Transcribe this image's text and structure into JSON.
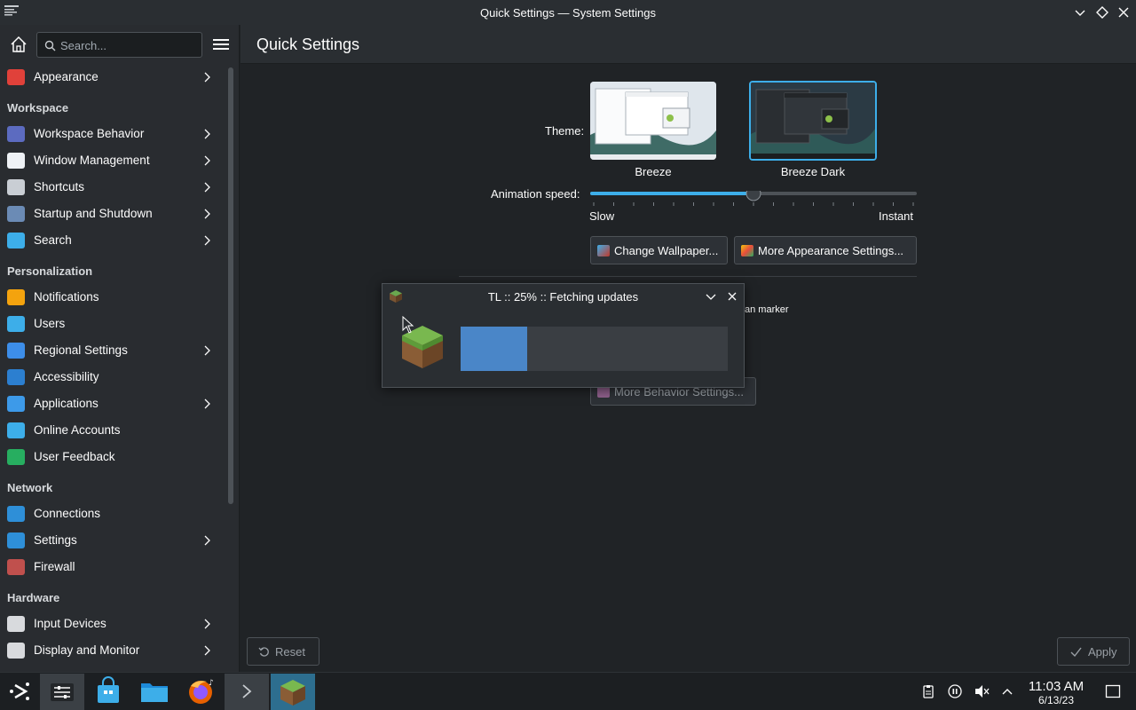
{
  "window": {
    "title": "Quick Settings — System Settings"
  },
  "sidebar": {
    "search_placeholder": "Search...",
    "items": [
      {
        "type": "item",
        "label": "Appearance",
        "icon": "appearance-icon",
        "color": "#e0413a",
        "chevron": true
      },
      {
        "type": "section",
        "label": "Workspace"
      },
      {
        "type": "item",
        "label": "Workspace Behavior",
        "icon": "workspace-behavior-icon",
        "color": "#5c6bc0",
        "chevron": true
      },
      {
        "type": "item",
        "label": "Window Management",
        "icon": "window-management-icon",
        "color": "#eef1f5",
        "chevron": true
      },
      {
        "type": "item",
        "label": "Shortcuts",
        "icon": "keyboard-icon",
        "color": "#c9ced4",
        "chevron": true
      },
      {
        "type": "item",
        "label": "Startup and Shutdown",
        "icon": "startup-icon",
        "color": "#6b8bb5",
        "chevron": true
      },
      {
        "type": "item",
        "label": "Search",
        "icon": "search-icon",
        "color": "#3daee9",
        "chevron": true
      },
      {
        "type": "section",
        "label": "Personalization"
      },
      {
        "type": "item",
        "label": "Notifications",
        "icon": "bell-icon",
        "color": "#f4a30e",
        "chevron": false
      },
      {
        "type": "item",
        "label": "Users",
        "icon": "users-icon",
        "color": "#3daee9",
        "chevron": false
      },
      {
        "type": "item",
        "label": "Regional Settings",
        "icon": "regional-icon",
        "color": "#3d8ee9",
        "chevron": true
      },
      {
        "type": "item",
        "label": "Accessibility",
        "icon": "accessibility-icon",
        "color": "#2c7fd0",
        "chevron": false
      },
      {
        "type": "item",
        "label": "Applications",
        "icon": "applications-icon",
        "color": "#3d9ae9",
        "chevron": true
      },
      {
        "type": "item",
        "label": "Online Accounts",
        "icon": "online-accounts-icon",
        "color": "#3daee9",
        "chevron": false
      },
      {
        "type": "item",
        "label": "User Feedback",
        "icon": "feedback-icon",
        "color": "#27ae60",
        "chevron": false
      },
      {
        "type": "section",
        "label": "Network"
      },
      {
        "type": "item",
        "label": "Connections",
        "icon": "globe-icon",
        "color": "#2e8fd8",
        "chevron": false
      },
      {
        "type": "item",
        "label": "Settings",
        "icon": "network-settings-icon",
        "color": "#2e8fd8",
        "chevron": true
      },
      {
        "type": "item",
        "label": "Firewall",
        "icon": "firewall-icon",
        "color": "#c0504d",
        "chevron": false
      },
      {
        "type": "section",
        "label": "Hardware"
      },
      {
        "type": "item",
        "label": "Input Devices",
        "icon": "mouse-icon",
        "color": "#d8dadd",
        "chevron": true
      },
      {
        "type": "item",
        "label": "Display and Monitor",
        "icon": "monitor-icon",
        "color": "#d8dadd",
        "chevron": true
      }
    ]
  },
  "main": {
    "title": "Quick Settings",
    "theme_label": "Theme:",
    "themes": [
      {
        "name": "Breeze",
        "selected": false
      },
      {
        "name": "Breeze Dark",
        "selected": true
      }
    ],
    "animation_label": "Animation speed:",
    "slider": {
      "min_label": "Slow",
      "max_label": "Instant",
      "value": 0.5
    },
    "change_wallpaper": "Change Wallpaper...",
    "more_appearance": "More Appearance Settings...",
    "partial_text": "an marker",
    "more_behavior": "More Behavior Settings...",
    "reset": "Reset",
    "apply": "Apply"
  },
  "dialog": {
    "title": "TL :: 25% :: Fetching updates",
    "progress": 0.25
  },
  "taskbar": {
    "time": "11:03 AM",
    "date": "6/13/23"
  },
  "colors": {
    "accent": "#3daee9",
    "progress": "#4a86c8"
  }
}
